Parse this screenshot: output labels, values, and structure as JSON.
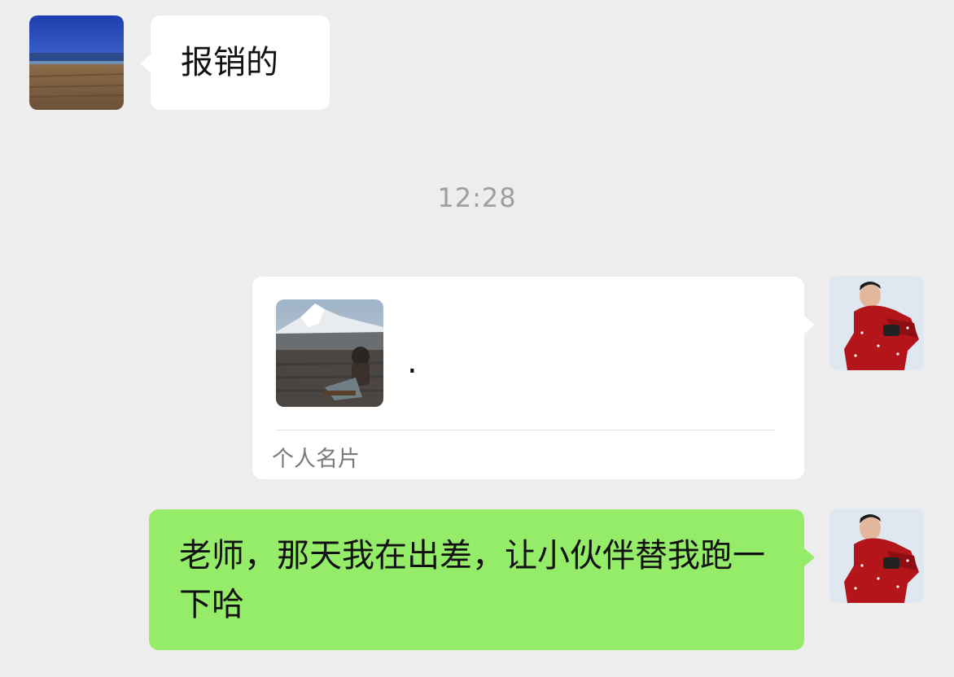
{
  "messages": [
    {
      "sender": "other",
      "type": "text",
      "text": "报销的"
    },
    {
      "type": "time",
      "text": "12:28"
    },
    {
      "sender": "self",
      "type": "contact_card",
      "name": ".",
      "label": "个人名片"
    },
    {
      "sender": "self",
      "type": "text",
      "text": "老师，那天我在出差，让小伙伴替我跑一下哈"
    }
  ],
  "colors": {
    "background": "#ededed",
    "self_bubble": "#95ec69",
    "other_bubble": "#ffffff",
    "timestamp": "#9e9e9e"
  }
}
